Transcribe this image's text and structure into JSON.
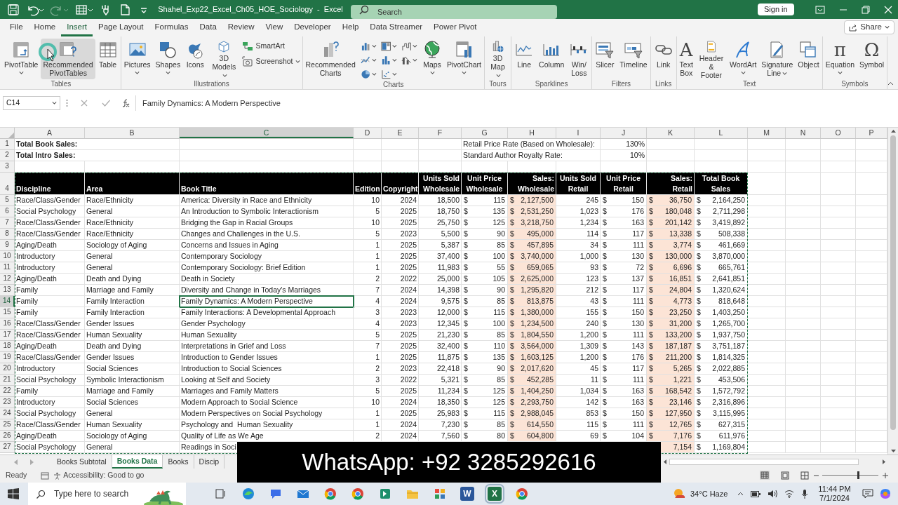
{
  "title_bar": {
    "quick_access": [
      {
        "disabled": false
      },
      {
        "disabled": false
      },
      {
        "disabled": true
      },
      {
        "disabled": false
      },
      {
        "disabled": false
      },
      {
        "disabled": false
      },
      {
        "disabled": false
      }
    ],
    "title": "Shahel_Exp22_Excel_Ch05_HOE_Sociology  -  Excel",
    "search": {
      "placeholder": "Search"
    },
    "sign_in": "Sign in"
  },
  "menu_tabs": [
    {
      "label": "File",
      "selected": false
    },
    {
      "label": "Home",
      "selected": false
    },
    {
      "label": "Insert",
      "selected": true
    },
    {
      "label": "Page Layout",
      "selected": false
    },
    {
      "label": "Formulas",
      "selected": false
    },
    {
      "label": "Data",
      "selected": false
    },
    {
      "label": "Review",
      "selected": false
    },
    {
      "label": "View",
      "selected": false
    },
    {
      "label": "Developer",
      "selected": false
    },
    {
      "label": "Help",
      "selected": false
    },
    {
      "label": "Data Streamer",
      "selected": false
    },
    {
      "label": "Power Pivot",
      "selected": false
    }
  ],
  "share": "Share",
  "ribbon_groups": [
    {
      "label": "Tables",
      "items": [
        {
          "kind": "large",
          "label": "PivotTable",
          "dropdown": true,
          "hovered": false
        },
        {
          "kind": "large",
          "label": "Recommended\nPivotTables",
          "dropdown": false,
          "hovered": true
        },
        {
          "kind": "large",
          "label": "Table",
          "dropdown": false,
          "hovered": false
        }
      ]
    },
    {
      "label": "Illustrations",
      "items": [
        {
          "kind": "large",
          "label": "Pictures",
          "dropdown": true,
          "hovered": false
        },
        {
          "kind": "large",
          "label": "Shapes",
          "dropdown": true,
          "hovered": false
        },
        {
          "kind": "large",
          "label": "Icons",
          "dropdown": false,
          "hovered": false
        },
        {
          "kind": "large",
          "label": "3D\nModels",
          "dropdown": true,
          "hovered": false
        },
        {
          "kind": "stack",
          "entries": [
            {
              "label": "SmartArt",
              "dropdown": false
            },
            {
              "label": "Screenshot",
              "dropdown": true
            }
          ]
        }
      ]
    },
    {
      "label": "Charts",
      "items": [
        {
          "kind": "large",
          "label": "Recommended\nCharts",
          "dropdown": false,
          "hovered": false
        },
        {
          "kind": "grid"
        },
        {
          "kind": "large",
          "label": "Maps",
          "dropdown": true,
          "hovered": false
        },
        {
          "kind": "large",
          "label": "PivotChart",
          "dropdown": true,
          "hovered": false
        }
      ]
    },
    {
      "label": "Tours",
      "items": [
        {
          "kind": "large",
          "label": "3D\nMap",
          "dropdown": true,
          "hovered": false
        }
      ]
    },
    {
      "label": "Sparklines",
      "items": [
        {
          "kind": "large",
          "label": "Line",
          "dropdown": false,
          "hovered": false
        },
        {
          "kind": "large",
          "label": "Column",
          "dropdown": false,
          "hovered": false
        },
        {
          "kind": "large",
          "label": "Win/\nLoss",
          "dropdown": false,
          "hovered": false
        }
      ]
    },
    {
      "label": "Filters",
      "items": [
        {
          "kind": "large",
          "label": "Slicer",
          "dropdown": false,
          "hovered": false
        },
        {
          "kind": "large",
          "label": "Timeline",
          "dropdown": false,
          "hovered": false
        }
      ]
    },
    {
      "label": "Links",
      "items": [
        {
          "kind": "large",
          "label": "Link",
          "dropdown": false,
          "hovered": false
        }
      ]
    },
    {
      "label": "Text",
      "items": [
        {
          "kind": "large",
          "label": "Text\nBox",
          "glyph": "A",
          "dropdown": false,
          "hovered": false
        },
        {
          "kind": "large",
          "label": "Header\n& Footer",
          "dropdown": false,
          "hovered": false
        },
        {
          "kind": "large",
          "label": "WordArt",
          "dropdown": true,
          "hovered": false
        },
        {
          "kind": "large",
          "label": "Signature\nLine",
          "dropdown": true,
          "hovered": false
        },
        {
          "kind": "large",
          "label": "Object",
          "dropdown": false,
          "hovered": false
        }
      ]
    },
    {
      "label": "Symbols",
      "items": [
        {
          "kind": "large",
          "label": "Equation",
          "glyph": "π",
          "dropdown": true,
          "hovered": false
        },
        {
          "kind": "large",
          "label": "Symbol",
          "glyph": "Ω",
          "dropdown": false,
          "hovered": false
        }
      ]
    }
  ],
  "formula_bar": {
    "name_box": "C14",
    "formula": "Family Dynamics: A Modern Perspective"
  },
  "columns": [
    {
      "letter": "A",
      "selected": false,
      "shaded": false
    },
    {
      "letter": "B",
      "selected": false,
      "shaded": false
    },
    {
      "letter": "C",
      "selected": true,
      "shaded": false
    },
    {
      "letter": "D",
      "selected": false,
      "shaded": false
    },
    {
      "letter": "E",
      "selected": false,
      "shaded": false
    },
    {
      "letter": "F",
      "selected": false,
      "shaded": false
    },
    {
      "letter": "G",
      "selected": false,
      "shaded": false
    },
    {
      "letter": "H",
      "selected": false,
      "shaded": true
    },
    {
      "letter": "I",
      "selected": false,
      "shaded": false
    },
    {
      "letter": "J",
      "selected": false,
      "shaded": false
    },
    {
      "letter": "K",
      "selected": false,
      "shaded": true
    },
    {
      "letter": "L",
      "selected": false,
      "shaded": false
    },
    {
      "letter": "M",
      "selected": false,
      "shaded": false
    },
    {
      "letter": "N",
      "selected": false,
      "shaded": false
    },
    {
      "letter": "O",
      "selected": false,
      "shaded": false
    },
    {
      "letter": "P",
      "selected": false,
      "shaded": false
    }
  ],
  "rows": [
    {
      "number": "1",
      "kind": "plain",
      "selected": false,
      "cells": {
        "A": "Total Book Sales:",
        "G": "Retail Price Rate (Based on Wholesale):",
        "J": "130%"
      }
    },
    {
      "number": "2",
      "kind": "plain",
      "selected": false,
      "cells": {
        "A": "Total Intro Sales:",
        "G": "Standard Author Royalty Rate:",
        "J": "10%"
      }
    },
    {
      "number": "3",
      "kind": "plain",
      "selected": false
    },
    {
      "number": "4",
      "kind": "header",
      "selected": false,
      "cells": {
        "A": "Discipline",
        "B": "Area",
        "C": "Book Title",
        "D": "Edition",
        "E": "Copyright",
        "F": "Units Sold\nWholesale",
        "G": "Unit Price\nWholesale",
        "H": "Sales:\nWholesale",
        "I": "Units Sold\nRetail",
        "J": "Unit Price\nRetail",
        "K": "Sales:\nRetail",
        "L": "Total Book\nSales"
      }
    },
    {
      "number": "5",
      "kind": "data",
      "selected": false,
      "cells": {
        "A": "Race/Class/Gender",
        "B": "Race/Ethnicity",
        "C": "America: Diversity in Race and Ethnicity",
        "D": "10",
        "E": "2024",
        "F": "18,500",
        "G": "$ 115",
        "H": "$ 2,127,500",
        "I": "245",
        "J": "$ 150",
        "K": "$ 36,750",
        "L": "$ 2,164,250"
      }
    },
    {
      "number": "6",
      "kind": "data",
      "selected": false,
      "cells": {
        "A": "Social Psychology",
        "B": "General",
        "C": "An Introduction to Symbolic Interactionism",
        "D": "5",
        "E": "2025",
        "F": "18,750",
        "G": "$ 135",
        "H": "$ 2,531,250",
        "I": "1,023",
        "J": "$ 176",
        "K": "$ 180,048",
        "L": "$ 2,711,298"
      }
    },
    {
      "number": "7",
      "kind": "data",
      "selected": false,
      "cells": {
        "A": "Race/Class/Gender",
        "B": "Race/Ethnicity",
        "C": "Bridging the Gap in Racial Groups",
        "D": "10",
        "E": "2025",
        "F": "25,750",
        "G": "$ 125",
        "H": "$ 3,218,750",
        "I": "1,234",
        "J": "$ 163",
        "K": "$ 201,142",
        "L": "$ 3,419,892"
      }
    },
    {
      "number": "8",
      "kind": "data",
      "selected": false,
      "cells": {
        "A": "Race/Class/Gender",
        "B": "Race/Ethnicity",
        "C": "Changes and Challenges in the U.S.",
        "D": "5",
        "E": "2023",
        "F": "5,500",
        "G": "$ 90",
        "H": "$ 495,000",
        "I": "114",
        "J": "$ 117",
        "K": "$ 13,338",
        "L": "$ 508,338"
      }
    },
    {
      "number": "9",
      "kind": "data",
      "selected": false,
      "cells": {
        "A": "Aging/Death",
        "B": "Sociology of Aging",
        "C": "Concerns and Issues in Aging",
        "D": "1",
        "E": "2025",
        "F": "5,387",
        "G": "$ 85",
        "H": "$ 457,895",
        "I": "34",
        "J": "$ 111",
        "K": "$ 3,774",
        "L": "$ 461,669"
      }
    },
    {
      "number": "10",
      "kind": "data",
      "selected": false,
      "cells": {
        "A": "Introductory",
        "B": "General",
        "C": "Contemporary Sociology",
        "D": "1",
        "E": "2025",
        "F": "37,400",
        "G": "$ 100",
        "H": "$ 3,740,000",
        "I": "1,000",
        "J": "$ 130",
        "K": "$ 130,000",
        "L": "$ 3,870,000"
      }
    },
    {
      "number": "11",
      "kind": "data",
      "selected": false,
      "cells": {
        "A": "Introductory",
        "B": "General",
        "C": "Contemporary Sociology: Brief Edition",
        "D": "1",
        "E": "2025",
        "F": "11,983",
        "G": "$ 55",
        "H": "$ 659,065",
        "I": "93",
        "J": "$ 72",
        "K": "$ 6,696",
        "L": "$ 665,761"
      }
    },
    {
      "number": "12",
      "kind": "data",
      "selected": false,
      "cells": {
        "A": "Aging/Death",
        "B": "Death and Dying",
        "C": "Death in Society",
        "D": "2",
        "E": "2022",
        "F": "25,000",
        "G": "$ 105",
        "H": "$ 2,625,000",
        "I": "123",
        "J": "$ 137",
        "K": "$ 16,851",
        "L": "$ 2,641,851"
      }
    },
    {
      "number": "13",
      "kind": "data",
      "selected": false,
      "cells": {
        "A": "Family",
        "B": "Marriage and Family",
        "C": "Diversity and Change in Today's Marriages",
        "D": "7",
        "E": "2024",
        "F": "14,398",
        "G": "$ 90",
        "H": "$ 1,295,820",
        "I": "212",
        "J": "$ 117",
        "K": "$ 24,804",
        "L": "$ 1,320,624"
      }
    },
    {
      "number": "14",
      "kind": "data",
      "selected": true,
      "cells": {
        "A": "Family",
        "B": "Family Interaction",
        "C": "Family Dynamics: A Modern Perspective",
        "D": "4",
        "E": "2024",
        "F": "9,575",
        "G": "$ 85",
        "H": "$ 813,875",
        "I": "43",
        "J": "$ 111",
        "K": "$ 4,773",
        "L": "$ 818,648"
      }
    },
    {
      "number": "15",
      "kind": "data",
      "selected": false,
      "cells": {
        "A": "Family",
        "B": "Family Interaction",
        "C": "Family Interactions: A Developmental Approach",
        "D": "3",
        "E": "2023",
        "F": "12,000",
        "G": "$ 115",
        "H": "$ 1,380,000",
        "I": "155",
        "J": "$ 150",
        "K": "$ 23,250",
        "L": "$ 1,403,250"
      }
    },
    {
      "number": "16",
      "kind": "data",
      "selected": false,
      "cells": {
        "A": "Race/Class/Gender",
        "B": "Gender Issues",
        "C": "Gender Psychology",
        "D": "4",
        "E": "2023",
        "F": "12,345",
        "G": "$ 100",
        "H": "$ 1,234,500",
        "I": "240",
        "J": "$ 130",
        "K": "$ 31,200",
        "L": "$ 1,265,700"
      }
    },
    {
      "number": "17",
      "kind": "data",
      "selected": false,
      "cells": {
        "A": "Race/Class/Gender",
        "B": "Human Sexuality",
        "C": "Human Sexuality",
        "D": "5",
        "E": "2025",
        "F": "21,230",
        "G": "$ 85",
        "H": "$ 1,804,550",
        "I": "1,200",
        "J": "$ 111",
        "K": "$ 133,200",
        "L": "$ 1,937,750"
      }
    },
    {
      "number": "18",
      "kind": "data",
      "selected": false,
      "cells": {
        "A": "Aging/Death",
        "B": "Death and Dying",
        "C": "Interpretations in Grief and Loss",
        "D": "7",
        "E": "2025",
        "F": "32,400",
        "G": "$ 110",
        "H": "$ 3,564,000",
        "I": "1,309",
        "J": "$ 143",
        "K": "$ 187,187",
        "L": "$ 3,751,187"
      }
    },
    {
      "number": "19",
      "kind": "data",
      "selected": false,
      "cells": {
        "A": "Race/Class/Gender",
        "B": "Gender Issues",
        "C": "Introduction to Gender Issues",
        "D": "1",
        "E": "2025",
        "F": "11,875",
        "G": "$ 135",
        "H": "$ 1,603,125",
        "I": "1,200",
        "J": "$ 176",
        "K": "$ 211,200",
        "L": "$ 1,814,325"
      }
    },
    {
      "number": "20",
      "kind": "data",
      "selected": false,
      "cells": {
        "A": "Introductory",
        "B": "Social Sciences",
        "C": "Introduction to Social Sciences",
        "D": "2",
        "E": "2023",
        "F": "22,418",
        "G": "$ 90",
        "H": "$ 2,017,620",
        "I": "45",
        "J": "$ 117",
        "K": "$ 5,265",
        "L": "$ 2,022,885"
      }
    },
    {
      "number": "21",
      "kind": "data",
      "selected": false,
      "cells": {
        "A": "Social Psychology",
        "B": "Symbolic Interactionism",
        "C": "Looking at Self and Society",
        "D": "3",
        "E": "2022",
        "F": "5,321",
        "G": "$ 85",
        "H": "$ 452,285",
        "I": "11",
        "J": "$ 111",
        "K": "$ 1,221",
        "L": "$ 453,506"
      }
    },
    {
      "number": "22",
      "kind": "data",
      "selected": false,
      "cells": {
        "A": "Family",
        "B": "Marriage and Family",
        "C": "Marriages and Family Matters",
        "D": "5",
        "E": "2025",
        "F": "11,234",
        "G": "$ 125",
        "H": "$ 1,404,250",
        "I": "1,034",
        "J": "$ 163",
        "K": "$ 168,542",
        "L": "$ 1,572,792"
      }
    },
    {
      "number": "23",
      "kind": "data",
      "selected": false,
      "cells": {
        "A": "Introductory",
        "B": "Social Sciences",
        "C": "Modern Approach to Social Science",
        "D": "10",
        "E": "2024",
        "F": "18,350",
        "G": "$ 125",
        "H": "$ 2,293,750",
        "I": "142",
        "J": "$ 163",
        "K": "$ 23,146",
        "L": "$ 2,316,896"
      }
    },
    {
      "number": "24",
      "kind": "data",
      "selected": false,
      "cells": {
        "A": "Social Psychology",
        "B": "General",
        "C": "Modern Perspectives on Social Psychology",
        "D": "1",
        "E": "2025",
        "F": "25,983",
        "G": "$ 115",
        "H": "$ 2,988,045",
        "I": "853",
        "J": "$ 150",
        "K": "$ 127,950",
        "L": "$ 3,115,995"
      }
    },
    {
      "number": "25",
      "kind": "data",
      "selected": false,
      "cells": {
        "A": "Race/Class/Gender",
        "B": "Human Sexuality",
        "C": "Psychology and  Human Sexuality",
        "D": "1",
        "E": "2024",
        "F": "7,230",
        "G": "$ 85",
        "H": "$ 614,550",
        "I": "115",
        "J": "$ 111",
        "K": "$ 12,765",
        "L": "$ 627,315"
      }
    },
    {
      "number": "26",
      "kind": "data",
      "selected": false,
      "cells": {
        "A": "Aging/Death",
        "B": "Sociology of Aging",
        "C": "Quality of Life as We Age",
        "D": "2",
        "E": "2024",
        "F": "7,560",
        "G": "$ 80",
        "H": "$ 604,800",
        "I": "69",
        "J": "$ 104",
        "K": "$ 7,176",
        "L": "$ 611,976"
      }
    },
    {
      "number": "27",
      "kind": "data",
      "selected": false,
      "cells": {
        "A": "Social Psychology",
        "B": "General",
        "C": "Readings in Soci",
        "K": "7,154",
        "L": "$ 1,169,804"
      }
    }
  ],
  "sheet_tabs": [
    {
      "label": "Books Subtotal",
      "selected": false
    },
    {
      "label": "Books Data",
      "selected": true
    },
    {
      "label": "Books",
      "selected": false
    },
    {
      "label": "Discip",
      "selected": false
    }
  ],
  "status_bar": {
    "mode": "Ready",
    "accessibility": "Accessibility: Good to go",
    "zoom": {
      "level": 0.62
    }
  },
  "banner": {
    "text": "WhatsApp: +92 3285292616"
  },
  "taskbar": {
    "search": {
      "placeholder": "Type here to search"
    },
    "apps": [
      {
        "active": false
      },
      {
        "active": false
      },
      {
        "active": false
      },
      {
        "active": false
      },
      {
        "active": false
      },
      {
        "active": false
      },
      {
        "active": false
      },
      {
        "active": false
      },
      {
        "active": false
      },
      {
        "active": false,
        "glyph": "W"
      },
      {
        "active": true,
        "glyph": "X"
      },
      {
        "active": false
      }
    ],
    "weather": "34°C Haze",
    "time": "11:44 PM",
    "date": "7/1/2024"
  }
}
